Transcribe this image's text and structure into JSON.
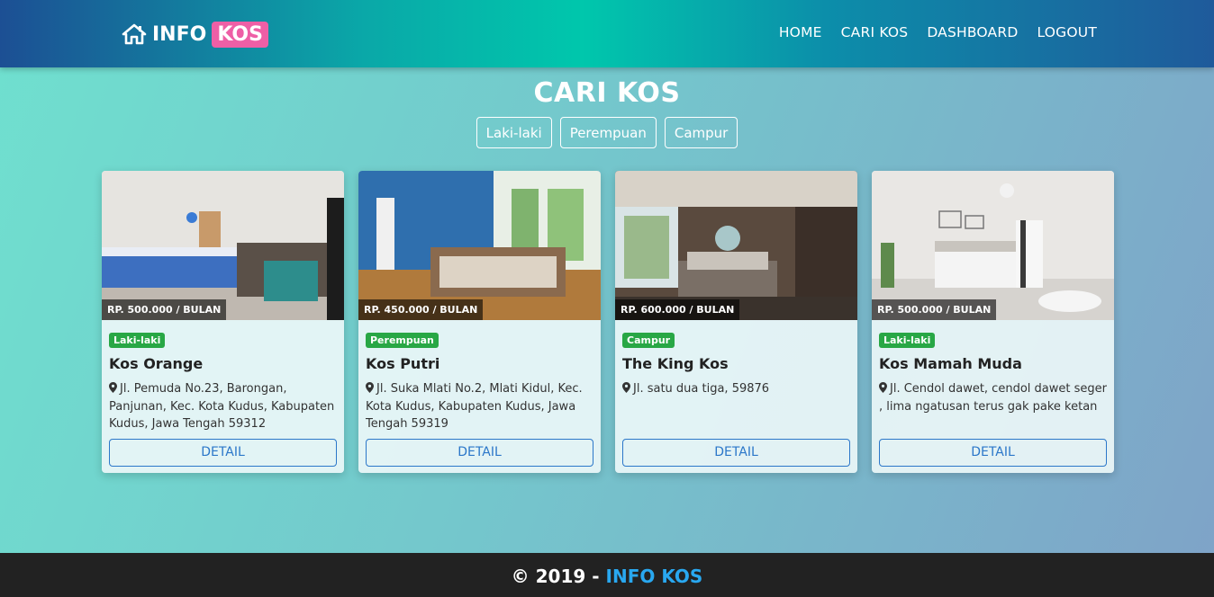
{
  "navbar": {
    "brand_info": "INFO",
    "brand_kos": "KOS",
    "links": [
      "HOME",
      "CARI KOS",
      "DASHBOARD",
      "LOGOUT"
    ]
  },
  "page": {
    "title": "CARI KOS",
    "filters": [
      "Laki-laki",
      "Perempuan",
      "Campur"
    ]
  },
  "cards": [
    {
      "price": "RP. 500.000 / BULAN",
      "badge": "Laki-laki",
      "name": "Kos Orange",
      "address": "Jl. Pemuda No.23, Barongan, Panjunan, Kec. Kota Kudus, Kabupaten Kudus, Jawa Tengah 59312",
      "button": "DETAIL"
    },
    {
      "price": "RP. 450.000 / BULAN",
      "badge": "Perempuan",
      "name": "Kos Putri",
      "address": "Jl. Suka Mlati No.2, Mlati Kidul, Kec. Kota Kudus, Kabupaten Kudus, Jawa Tengah 59319",
      "button": "DETAIL"
    },
    {
      "price": "RP. 600.000 / BULAN",
      "badge": "Campur",
      "name": "The King Kos",
      "address": "Jl. satu dua tiga, 59876",
      "button": "DETAIL"
    },
    {
      "price": "RP. 500.000 / BULAN",
      "badge": "Laki-laki",
      "name": "Kos Mamah Muda",
      "address": "Jl. Cendol dawet, cendol dawet seger , lima ngatusan terus gak pake ketan",
      "button": "DETAIL"
    }
  ],
  "footer": {
    "prefix": "© 2019 - ",
    "brand": "INFO KOS"
  },
  "colors": {
    "accent_pink": "#ee5fa6",
    "badge_green": "#28a745",
    "detail_blue": "#2b77c9",
    "footer_brand": "#29a8f0"
  },
  "icons": [
    "home-icon",
    "map-marker-icon"
  ]
}
